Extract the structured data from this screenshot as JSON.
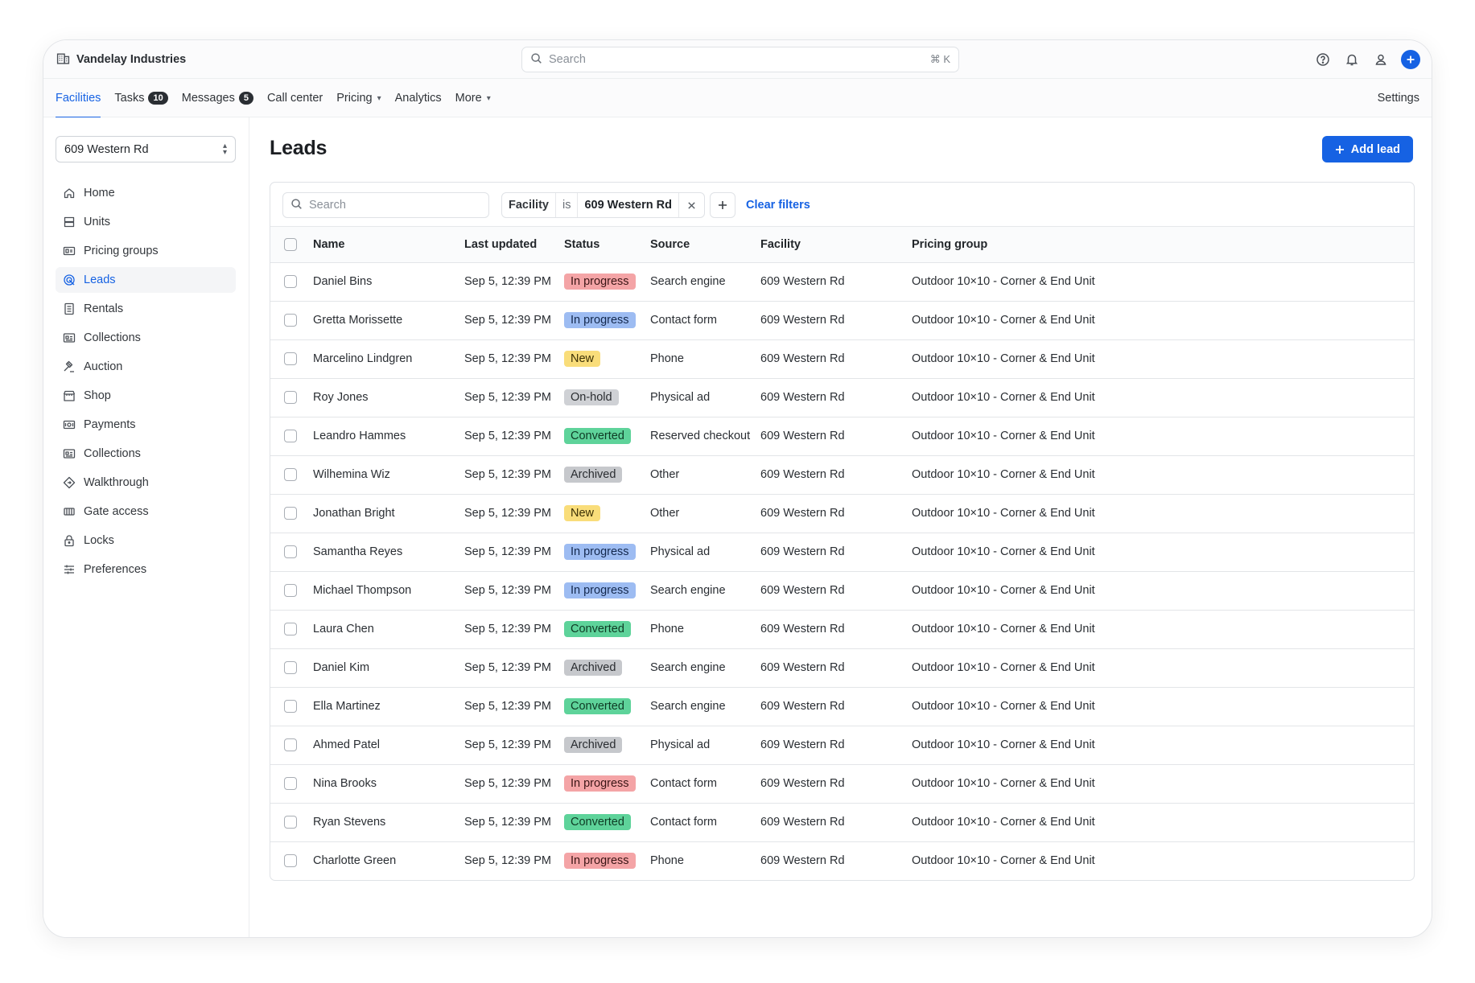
{
  "app": {
    "org_name": "Vandelay Industries"
  },
  "search": {
    "placeholder": "Search",
    "shortcut": "⌘ K"
  },
  "nav": {
    "tabs": [
      {
        "label": "Facilities",
        "active": true
      },
      {
        "label": "Tasks",
        "count": "10"
      },
      {
        "label": "Messages",
        "count": "5"
      },
      {
        "label": "Call center"
      },
      {
        "label": "Pricing",
        "dropdown": true
      },
      {
        "label": "Analytics"
      },
      {
        "label": "More",
        "dropdown": true
      }
    ],
    "settings_label": "Settings"
  },
  "sidebar": {
    "facility": "609 Western Rd",
    "items": [
      {
        "label": "Home",
        "icon": "home-icon"
      },
      {
        "label": "Units",
        "icon": "units-icon"
      },
      {
        "label": "Pricing groups",
        "icon": "pricing-groups-icon"
      },
      {
        "label": "Leads",
        "icon": "leads-icon",
        "active": true
      },
      {
        "label": "Rentals",
        "icon": "rentals-icon"
      },
      {
        "label": "Collections",
        "icon": "collections-icon"
      },
      {
        "label": "Auction",
        "icon": "gavel-icon"
      },
      {
        "label": "Shop",
        "icon": "shop-icon"
      },
      {
        "label": "Payments",
        "icon": "payments-icon"
      },
      {
        "label": "Collections",
        "icon": "collections-icon"
      },
      {
        "label": "Walkthrough",
        "icon": "walkthrough-icon"
      },
      {
        "label": "Gate access",
        "icon": "gate-icon"
      },
      {
        "label": "Locks",
        "icon": "lock-icon"
      },
      {
        "label": "Preferences",
        "icon": "sliders-icon"
      }
    ]
  },
  "page": {
    "title": "Leads",
    "add_button": "Add lead"
  },
  "filters": {
    "search_placeholder": "Search",
    "chip": {
      "field": "Facility",
      "operator": "is",
      "value": "609 Western Rd"
    },
    "clear_label": "Clear filters"
  },
  "table": {
    "columns": [
      "Name",
      "Last updated",
      "Status",
      "Source",
      "Facility",
      "Pricing group"
    ],
    "rows": [
      {
        "name": "Daniel Bins",
        "updated": "Sep 5, 12:39 PM",
        "status": "In progress",
        "status_style": "b-progress-red",
        "source": "Search engine",
        "facility": "609 Western Rd",
        "pricing_group": "Outdoor 10×10 - Corner & End Unit"
      },
      {
        "name": "Gretta Morissette",
        "updated": "Sep 5, 12:39 PM",
        "status": "In progress",
        "status_style": "b-progress-blue",
        "source": "Contact form",
        "facility": "609 Western Rd",
        "pricing_group": "Outdoor 10×10 - Corner & End Unit"
      },
      {
        "name": "Marcelino Lindgren",
        "updated": "Sep 5, 12:39 PM",
        "status": "New",
        "status_style": "b-new",
        "source": "Phone",
        "facility": "609 Western Rd",
        "pricing_group": "Outdoor 10×10 - Corner & End Unit"
      },
      {
        "name": "Roy Jones",
        "updated": "Sep 5, 12:39 PM",
        "status": "On-hold",
        "status_style": "b-hold",
        "source": "Physical ad",
        "facility": "609 Western Rd",
        "pricing_group": "Outdoor 10×10 - Corner & End Unit"
      },
      {
        "name": "Leandro Hammes",
        "updated": "Sep 5, 12:39 PM",
        "status": "Converted",
        "status_style": "b-converted",
        "source": "Reserved checkout",
        "facility": "609 Western Rd",
        "pricing_group": "Outdoor 10×10 - Corner & End Unit"
      },
      {
        "name": "Wilhemina Wiz",
        "updated": "Sep 5, 12:39 PM",
        "status": "Archived",
        "status_style": "b-archived",
        "source": "Other",
        "facility": "609 Western Rd",
        "pricing_group": "Outdoor 10×10 - Corner & End Unit"
      },
      {
        "name": "Jonathan Bright",
        "updated": "Sep 5, 12:39 PM",
        "status": "New",
        "status_style": "b-new",
        "source": "Other",
        "facility": "609 Western Rd",
        "pricing_group": "Outdoor 10×10 - Corner & End Unit"
      },
      {
        "name": "Samantha Reyes",
        "updated": "Sep 5, 12:39 PM",
        "status": "In progress",
        "status_style": "b-progress-blue",
        "source": "Physical ad",
        "facility": "609 Western Rd",
        "pricing_group": "Outdoor 10×10 - Corner & End Unit"
      },
      {
        "name": "Michael Thompson",
        "updated": "Sep 5, 12:39 PM",
        "status": "In progress",
        "status_style": "b-progress-blue",
        "source": "Search engine",
        "facility": "609 Western Rd",
        "pricing_group": "Outdoor 10×10 - Corner & End Unit"
      },
      {
        "name": "Laura Chen",
        "updated": "Sep 5, 12:39 PM",
        "status": "Converted",
        "status_style": "b-converted",
        "source": "Phone",
        "facility": "609 Western Rd",
        "pricing_group": "Outdoor 10×10 - Corner & End Unit"
      },
      {
        "name": "Daniel Kim",
        "updated": "Sep 5, 12:39 PM",
        "status": "Archived",
        "status_style": "b-archived",
        "source": "Search engine",
        "facility": "609 Western Rd",
        "pricing_group": "Outdoor 10×10 - Corner & End Unit"
      },
      {
        "name": "Ella Martinez",
        "updated": "Sep 5, 12:39 PM",
        "status": "Converted",
        "status_style": "b-converted",
        "source": "Search engine",
        "facility": "609 Western Rd",
        "pricing_group": "Outdoor 10×10 - Corner & End Unit"
      },
      {
        "name": "Ahmed Patel",
        "updated": "Sep 5, 12:39 PM",
        "status": "Archived",
        "status_style": "b-archived",
        "source": "Physical ad",
        "facility": "609 Western Rd",
        "pricing_group": "Outdoor 10×10 - Corner & End Unit"
      },
      {
        "name": "Nina Brooks",
        "updated": "Sep 5, 12:39 PM",
        "status": "In progress",
        "status_style": "b-progress-red",
        "source": "Contact form",
        "facility": "609 Western Rd",
        "pricing_group": "Outdoor 10×10 - Corner & End Unit"
      },
      {
        "name": "Ryan Stevens",
        "updated": "Sep 5, 12:39 PM",
        "status": "Converted",
        "status_style": "b-converted",
        "source": "Contact form",
        "facility": "609 Western Rd",
        "pricing_group": "Outdoor 10×10 - Corner & End Unit"
      },
      {
        "name": "Charlotte Green",
        "updated": "Sep 5, 12:39 PM",
        "status": "In progress",
        "status_style": "b-progress-red",
        "source": "Phone",
        "facility": "609 Western Rd",
        "pricing_group": "Outdoor 10×10 - Corner & End Unit"
      }
    ]
  },
  "colors": {
    "accent": "#1662e3",
    "badge_red": "#f4a4a6",
    "badge_blue": "#9dbcf2",
    "badge_yellow": "#f9dd7a",
    "badge_green": "#5ed39a",
    "badge_gray": "#c6c8cc"
  }
}
